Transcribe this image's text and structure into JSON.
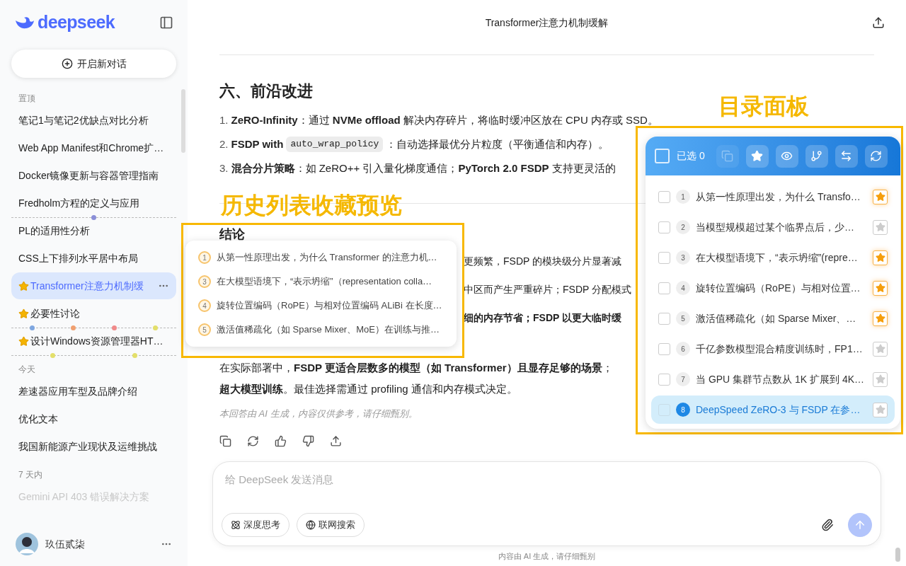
{
  "sidebar": {
    "logo": "deepseek",
    "new_chat": "开启新对话",
    "sections": [
      {
        "label": "置顶",
        "items": [
          {
            "title": "笔记1与笔记2优缺点对比分析",
            "starred": false,
            "selected": false
          },
          {
            "title": "Web App Manifest和Chrome扩…",
            "starred": false,
            "selected": false
          },
          {
            "title": "Docker镜像更新与容器管理指南",
            "starred": false,
            "selected": false
          },
          {
            "title": "Fredholm方程的定义与应用",
            "starred": false,
            "selected": false,
            "markers": [
              {
                "color": "#8b8fd8"
              }
            ]
          },
          {
            "title": "PL的适用性分析",
            "starred": false,
            "selected": false
          },
          {
            "title": "CSS上下排列水平居中布局",
            "starred": false,
            "selected": false
          },
          {
            "title": "Transformer注意力机制缓",
            "starred": true,
            "selected": true
          },
          {
            "title": "必要性讨论",
            "starred": true,
            "selected": false,
            "markers": [
              {
                "color": "#7fa7e0"
              },
              {
                "color": "#f0a070"
              },
              {
                "color": "#f08a8a"
              },
              {
                "color": "#e3df6a"
              }
            ]
          },
          {
            "title": "设计Windows资源管理器HT…",
            "starred": true,
            "selected": false,
            "markers": [
              {
                "color": "#e3df6a"
              },
              {
                "color": "#e3df6a"
              }
            ]
          }
        ]
      },
      {
        "label": "今天",
        "items": [
          {
            "title": "差速器应用车型及品牌介绍",
            "starred": false,
            "selected": false
          },
          {
            "title": "优化文本",
            "starred": false,
            "selected": false
          },
          {
            "title": "我国新能源产业现状及运维挑战",
            "starred": false,
            "selected": false
          }
        ]
      },
      {
        "label": "7 天内",
        "items": [
          {
            "title": "Gemini API 403 错误解决方案",
            "starred": false,
            "selected": false
          }
        ]
      }
    ],
    "user": {
      "name": "玖伍贰柒"
    }
  },
  "header": {
    "title": "Transformer注意力机制缓解"
  },
  "article": {
    "heading": "六、前沿改进",
    "list": [
      {
        "number": "1.",
        "segments": [
          {
            "kind": "text",
            "text": "**ZeRO-Infinity**：通过 **NVMe offload** 解决内存碎片，将临时缓冲区放在 CPU 内存或 SSD。"
          }
        ]
      },
      {
        "number": "2.",
        "segments": [
          {
            "kind": "text",
            "text": "**FSDP with**"
          },
          {
            "kind": "code",
            "text": "auto_wrap_policy"
          },
          {
            "kind": "text",
            "text": "：自动选择最优分片粒度（平衡通信和内存）。"
          }
        ]
      },
      {
        "number": "3.",
        "segments": [
          {
            "kind": "text",
            "text": "**混合分片策略**：如 ZeRO++ 引入量化梯度通信；**PyTorch 2.0 FSDP** 支持更灵活的"
          }
        ]
      }
    ],
    "conclusion_heading": "结论",
    "conclusion_lines": [
      {
        "kind": "partial",
        "text": "更频繁，FSDP 的模块级分片显著减"
      },
      {
        "kind": "partial",
        "text": "中区而产生严重碎片；FSDP 分配模式"
      },
      {
        "kind": "partial",
        "text": "**细的内存节省；FSDP 以更大临时缓**"
      },
      {
        "kind": "full",
        "text": "在实际部署中，**FSDP 更适合层数多的模型（如 Transformer）且显存足够的场景**；"
      },
      {
        "kind": "full",
        "text": "**超大模型训练**。最佳选择需通过 profiling 通信和内存模式决定。"
      }
    ],
    "note": "本回答由 AI 生成，内容仅供参考，请仔细甄别。"
  },
  "composer": {
    "placeholder": "给 DeepSeek 发送消息",
    "buttons": [
      {
        "kind": "think",
        "label": "深度思考"
      },
      {
        "kind": "search",
        "label": "联网搜索"
      }
    ]
  },
  "footer": "内容由 AI 生成，请仔细甄别",
  "preview": {
    "callout": "历史列表收藏预览",
    "items": [
      {
        "number": "1",
        "text": "从第一性原理出发，为什么 Transformer 的注意力机…"
      },
      {
        "number": "3",
        "text": "在大模型语境下，“表示坍缩”（representation colla…"
      },
      {
        "number": "4",
        "text": "旋转位置编码（RoPE）与相对位置编码 ALiBi 在长度…"
      },
      {
        "number": "5",
        "text": "激活值稀疏化（如 Sparse Mixer、MoE）在训练与推…"
      }
    ]
  },
  "toc": {
    "callout": "目录面板",
    "selected_count": "已选 0",
    "all_checked": false,
    "items": [
      {
        "number": "1",
        "text": "从第一性原理出发，为什么 Transfo…",
        "checked": false,
        "starred": true,
        "selected": false
      },
      {
        "number": "2",
        "text": "当模型规模超过某个临界点后，少…",
        "checked": false,
        "starred": false,
        "selected": false
      },
      {
        "number": "3",
        "text": "在大模型语境下，“表示坍缩”(repre…",
        "checked": false,
        "starred": true,
        "selected": false
      },
      {
        "number": "4",
        "text": "旋转位置编码（RoPE）与相对位置…",
        "checked": false,
        "starred": true,
        "selected": false
      },
      {
        "number": "5",
        "text": "激活值稀疏化（如 Sparse Mixer、…",
        "checked": false,
        "starred": true,
        "selected": false
      },
      {
        "number": "6",
        "text": "千亿参数模型混合精度训练时，FP1…",
        "checked": false,
        "starred": false,
        "selected": false
      },
      {
        "number": "7",
        "text": "当 GPU 集群节点数从 1K 扩展到 4K…",
        "checked": false,
        "starred": false,
        "selected": false
      },
      {
        "number": "8",
        "text": "DeepSpeed ZeRO-3 与 FSDP 在参…",
        "checked": false,
        "starred": false,
        "selected": true
      }
    ]
  }
}
